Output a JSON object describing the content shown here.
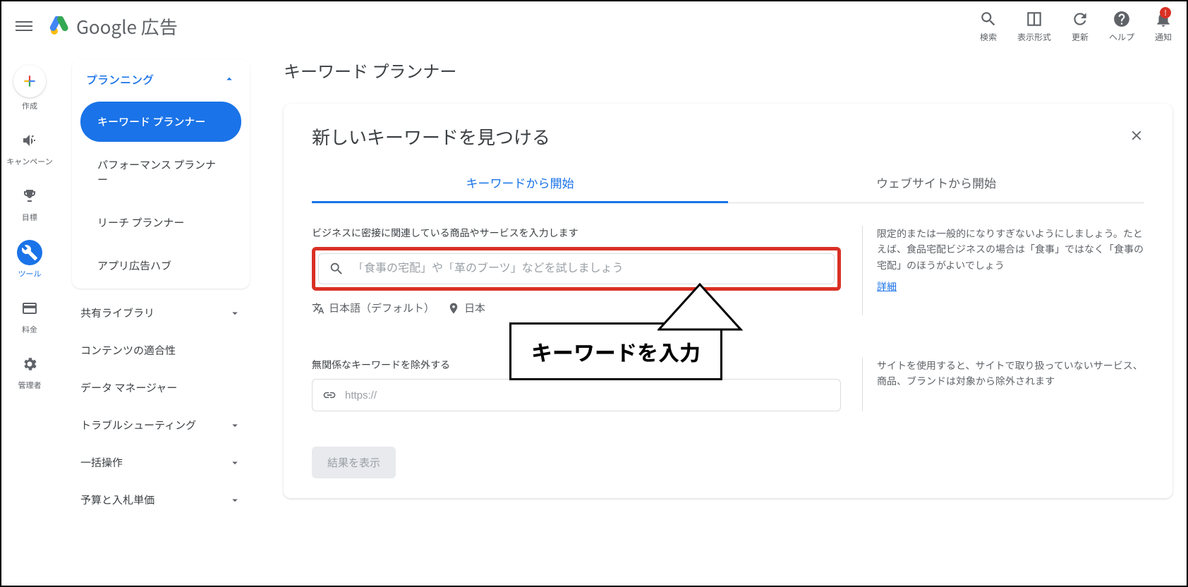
{
  "header": {
    "logo_text": "Google 広告",
    "icons": {
      "search": "検索",
      "display": "表示形式",
      "refresh": "更新",
      "help": "ヘルプ",
      "notifications": "通知"
    },
    "notif_badge": "!"
  },
  "left_rail": [
    {
      "id": "create",
      "label": "作成"
    },
    {
      "id": "campaign",
      "label": "キャンペーン"
    },
    {
      "id": "goals",
      "label": "目標"
    },
    {
      "id": "tools",
      "label": "ツール",
      "active": true
    },
    {
      "id": "billing",
      "label": "料金"
    },
    {
      "id": "admin",
      "label": "管理者"
    }
  ],
  "sidebar": {
    "planning_header": "プランニング",
    "planning_items": [
      {
        "label": "キーワード プランナー",
        "active": true
      },
      {
        "label": "パフォーマンス プランナー"
      },
      {
        "label": "リーチ プランナー"
      },
      {
        "label": "アプリ広告ハブ"
      }
    ],
    "other_rows": [
      "共有ライブラリ",
      "コンテンツの適合性",
      "データ マネージャー",
      "トラブルシューティング",
      "一括操作",
      "予算と入札単価"
    ]
  },
  "main": {
    "page_title": "キーワード プランナー",
    "card_title": "新しいキーワードを見つける",
    "tabs": [
      {
        "label": "キーワードから開始",
        "active": true
      },
      {
        "label": "ウェブサイトから開始"
      }
    ],
    "keyword_section": {
      "label": "ビジネスに密接に関連している商品やサービスを入力します",
      "placeholder": "「食事の宅配」や「革のブーツ」などを試しましょう",
      "language": "日本語（デフォルト）",
      "location": "日本",
      "tip": "限定的または一般的になりすぎないようにしましょう。たとえば、食品宅配ビジネスの場合は「食事」ではなく「食事の宅配」のほうがよいでしょう",
      "detail_link": "詳細"
    },
    "url_section": {
      "label": "無関係なキーワードを除外する",
      "placeholder": "https://",
      "tip": "サイトを使用すると、サイトで取り扱っていないサービス、商品、ブランドは対象から除外されます"
    },
    "submit_button": "結果を表示"
  },
  "annotation": {
    "text": "キーワードを入力"
  }
}
